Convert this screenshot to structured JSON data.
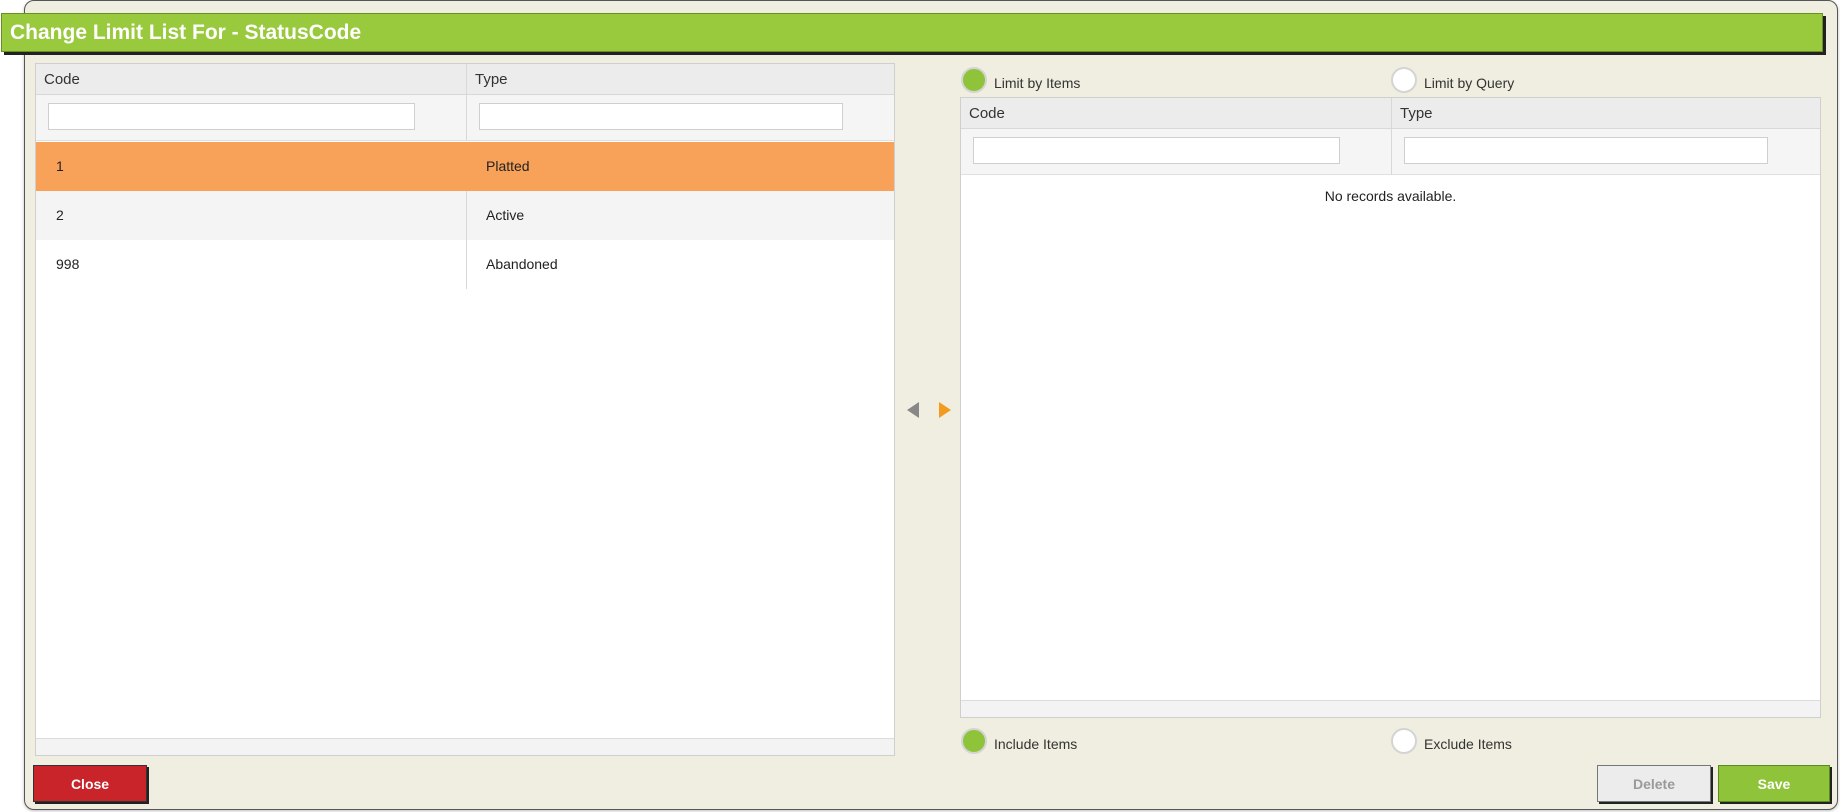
{
  "dialog": {
    "title": "Change Limit List For - StatusCode"
  },
  "left_grid": {
    "columns": [
      "Code",
      "Type"
    ],
    "rows": [
      {
        "code": "1",
        "type": "Platted",
        "selected": true
      },
      {
        "code": "2",
        "type": "Active",
        "selected": false
      },
      {
        "code": "998",
        "type": "Abandoned",
        "selected": false
      }
    ],
    "filter_code_value": "",
    "filter_type_value": ""
  },
  "transfer": {
    "left_arrow_icon": "triangle-left-icon",
    "right_arrow_icon": "triangle-right-icon",
    "left_arrow_color": "#888888",
    "right_arrow_color": "#f39b1f"
  },
  "limit_mode": {
    "options": [
      {
        "label": "Limit by Items",
        "checked": true
      },
      {
        "label": "Limit by Query",
        "checked": false
      }
    ]
  },
  "right_grid": {
    "columns": [
      "Code",
      "Type"
    ],
    "empty_message": "No records available.",
    "filter_code_value": "",
    "filter_type_value": ""
  },
  "include_mode": {
    "options": [
      {
        "label": "Include Items",
        "checked": true
      },
      {
        "label": "Exclude Items",
        "checked": false
      }
    ]
  },
  "buttons": {
    "close": "Close",
    "delete": "Delete",
    "save": "Save"
  },
  "colors": {
    "title_bar": "#99c93c",
    "selected_row": "#f7a159",
    "close_button": "#c9242a",
    "save_button": "#8fc43a"
  }
}
